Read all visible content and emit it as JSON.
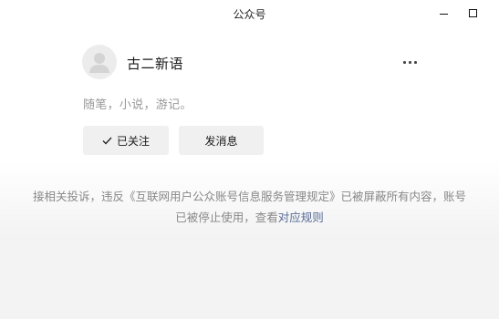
{
  "window": {
    "title": "公众号"
  },
  "account": {
    "name": "古二新语",
    "intro": "随笔，小说，游记。",
    "avatar_icon": "default-user-icon"
  },
  "actions": {
    "followed_label": "已关注",
    "message_label": "发消息",
    "more_icon": "more-horizontal-icon"
  },
  "notice": {
    "text": "接相关投诉，违反《互联网用户公众账号信息服务管理规定》已被屏蔽所有内容，账号已被停止使用，查看",
    "link_label": "对应规则"
  },
  "colors": {
    "link": "#576b95",
    "muted_text": "#888888",
    "button_bg": "#f0f0f0"
  }
}
